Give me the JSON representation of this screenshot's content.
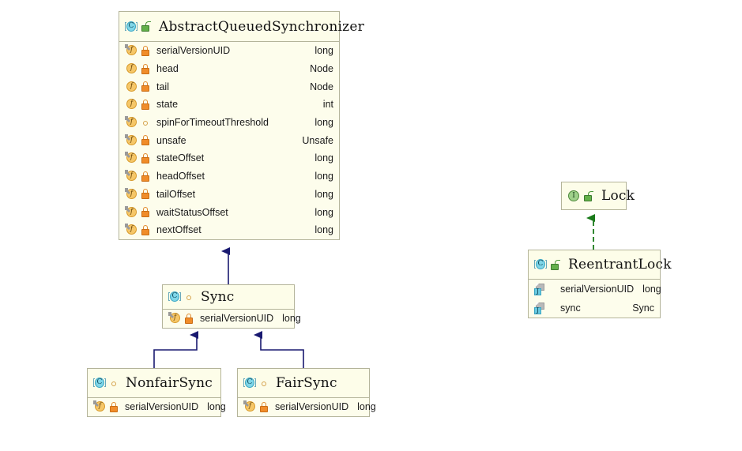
{
  "diagram": {
    "title": "AbstractQueuedSynchronizer class hierarchy",
    "background": "#ffffff",
    "node_fill": "#fdfdec",
    "node_header_fill": "#fdfde9",
    "node_border": "#b4b49a",
    "inheritance_color": "#191970",
    "realization_color": "#1a7a1a"
  },
  "nodes": {
    "aqs": {
      "name": "AbstractQueuedSynchronizer",
      "stereotype_icon": "class-icon",
      "visibility_icon": "public-unlock-icon",
      "members": [
        {
          "name": "serialVersionUID",
          "type": "long",
          "icon": "static-field-icon",
          "visibility": "private-lock-icon"
        },
        {
          "name": "head",
          "type": "Node",
          "icon": "field-icon",
          "visibility": "private-lock-icon"
        },
        {
          "name": "tail",
          "type": "Node",
          "icon": "field-icon",
          "visibility": "private-lock-icon"
        },
        {
          "name": "state",
          "type": "int",
          "icon": "field-icon",
          "visibility": "private-lock-icon"
        },
        {
          "name": "spinForTimeoutThreshold",
          "type": "long",
          "icon": "static-field-icon",
          "visibility": "package-circle-icon"
        },
        {
          "name": "unsafe",
          "type": "Unsafe",
          "icon": "static-field-icon",
          "visibility": "private-lock-icon"
        },
        {
          "name": "stateOffset",
          "type": "long",
          "icon": "static-field-icon",
          "visibility": "private-lock-icon"
        },
        {
          "name": "headOffset",
          "type": "long",
          "icon": "static-field-icon",
          "visibility": "private-lock-icon"
        },
        {
          "name": "tailOffset",
          "type": "long",
          "icon": "static-field-icon",
          "visibility": "private-lock-icon"
        },
        {
          "name": "waitStatusOffset",
          "type": "long",
          "icon": "static-field-icon",
          "visibility": "private-lock-icon"
        },
        {
          "name": "nextOffset",
          "type": "long",
          "icon": "static-field-icon",
          "visibility": "private-lock-icon"
        }
      ]
    },
    "sync": {
      "name": "Sync",
      "stereotype_icon": "class-icon",
      "visibility_icon": "package-circle-icon",
      "members": [
        {
          "name": "serialVersionUID",
          "type": "long",
          "icon": "static-field-icon",
          "visibility": "private-lock-icon"
        }
      ]
    },
    "nonfair_sync": {
      "name": "NonfairSync",
      "stereotype_icon": "class-icon",
      "visibility_icon": "package-circle-icon",
      "members": [
        {
          "name": "serialVersionUID",
          "type": "long",
          "icon": "static-field-icon",
          "visibility": "private-lock-icon"
        }
      ]
    },
    "fair_sync": {
      "name": "FairSync",
      "stereotype_icon": "class-icon",
      "visibility_icon": "package-circle-icon",
      "members": [
        {
          "name": "serialVersionUID",
          "type": "long",
          "icon": "static-field-icon",
          "visibility": "private-lock-icon"
        }
      ]
    },
    "lock": {
      "name": "Lock",
      "stereotype_icon": "interface-icon",
      "visibility_icon": "public-unlock-icon",
      "members": []
    },
    "reentrant_lock": {
      "name": "ReentrantLock",
      "stereotype_icon": "class-icon",
      "visibility_icon": "public-unlock-icon",
      "members": [
        {
          "name": "serialVersionUID",
          "type": "long",
          "icon": "java-file-icon",
          "visibility": "none"
        },
        {
          "name": "sync",
          "type": "Sync",
          "icon": "java-file-icon",
          "visibility": "none"
        }
      ]
    }
  },
  "edges": [
    {
      "from": "sync",
      "to": "aqs",
      "kind": "inheritance"
    },
    {
      "from": "nonfair_sync",
      "to": "sync",
      "kind": "inheritance"
    },
    {
      "from": "fair_sync",
      "to": "sync",
      "kind": "inheritance"
    },
    {
      "from": "reentrant_lock",
      "to": "lock",
      "kind": "realization"
    }
  ]
}
